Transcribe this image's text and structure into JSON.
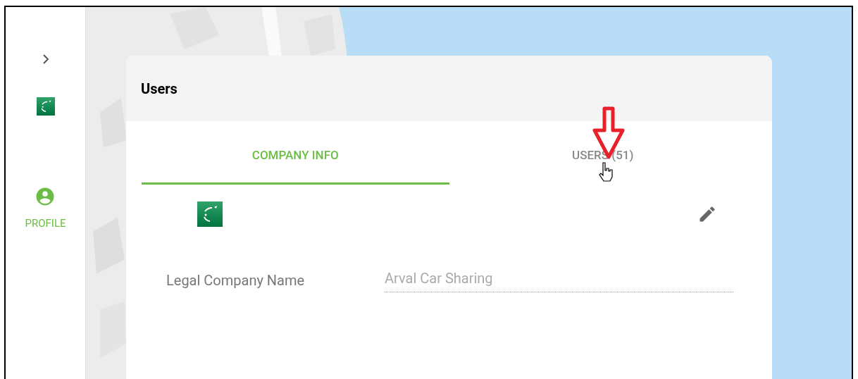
{
  "sidebar": {
    "items": [
      {
        "kind": "expand"
      },
      {
        "kind": "logo"
      },
      {
        "kind": "profile",
        "label": "PROFILE",
        "selected": true
      }
    ]
  },
  "card": {
    "title": "Users",
    "tabs": [
      {
        "label": "COMPANY INFO",
        "selected": true
      },
      {
        "label": "USERS (51)",
        "selected": false
      }
    ],
    "fields": [
      {
        "label": "Legal Company Name",
        "value": "Arval Car Sharing",
        "disabled": true
      }
    ]
  }
}
